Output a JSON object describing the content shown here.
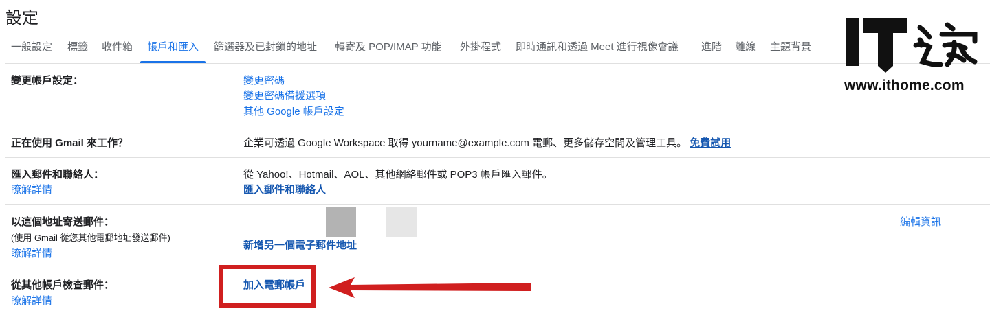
{
  "page": {
    "title": "設定"
  },
  "tabs": [
    {
      "label": "一般設定",
      "active": false
    },
    {
      "label": "標籤",
      "active": false
    },
    {
      "label": "收件箱",
      "active": false
    },
    {
      "label": "帳戶和匯入",
      "active": true
    },
    {
      "label": "篩選器及已封鎖的地址",
      "active": false
    },
    {
      "label": "轉寄及 POP/IMAP 功能",
      "active": false
    },
    {
      "label": "外掛程式",
      "active": false
    },
    {
      "label": "即時通訊和透過 Meet 進行視像會議",
      "active": false
    },
    {
      "label": "進階",
      "active": false
    },
    {
      "label": "離線",
      "active": false
    },
    {
      "label": "主題背景",
      "active": false
    }
  ],
  "sections": {
    "change_account": {
      "label": "變更帳戶設定：",
      "links": [
        "變更密碼",
        "變更密碼備援選項",
        "其他 Google 帳戶設定"
      ]
    },
    "work": {
      "label": "正在使用 Gmail 來工作？",
      "text": "企業可透過 Google Workspace 取得 yourname@example.com 電郵、更多儲存空間及管理工具。",
      "link": "免費試用"
    },
    "import": {
      "label": "匯入郵件和聯絡人：",
      "help": "瞭解詳情",
      "text": "從 Yahoo!、Hotmail、AOL、其他網絡郵件或 POP3 帳戶匯入郵件。",
      "link": "匯入郵件和聯絡人"
    },
    "send_as": {
      "label": "以這個地址寄送郵件：",
      "sub": "(使用 Gmail 從您其他電郵地址發送郵件)",
      "help": "瞭解詳情",
      "link": "新增另一個電子郵件地址",
      "edit": "編輯資訊"
    },
    "check_mail": {
      "label": "從其他帳戶檢查郵件：",
      "help": "瞭解詳情",
      "link": "加入電郵帳戶"
    }
  },
  "watermark": {
    "brand": "IT之家",
    "url": "www.ithome.com"
  },
  "colors": {
    "accent": "#1a73e8",
    "annotation": "#d01f1f",
    "divider": "#e0e0e0"
  }
}
